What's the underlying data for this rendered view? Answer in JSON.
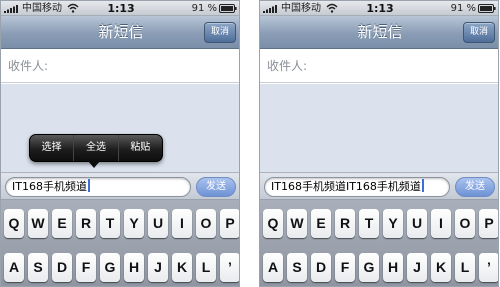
{
  "panels": [
    {
      "status": {
        "carrier": "中国移动",
        "time": "1:13",
        "battery_text": "91 %"
      },
      "nav": {
        "title": "新短信",
        "cancel_label": "取消"
      },
      "recipient": {
        "label": "收件人:"
      },
      "edit_menu": {
        "items": [
          "选择",
          "全选",
          "粘贴"
        ]
      },
      "compose": {
        "text": "IT168手机频道",
        "send_label": "发送"
      },
      "keyboard": {
        "row1": [
          "Q",
          "W",
          "E",
          "R",
          "T",
          "Y",
          "U",
          "I",
          "O",
          "P"
        ],
        "row2": [
          "A",
          "S",
          "D",
          "F",
          "G",
          "H",
          "J",
          "K",
          "L",
          "’"
        ]
      }
    },
    {
      "status": {
        "carrier": "中国移动",
        "time": "1:13",
        "battery_text": "91 %"
      },
      "nav": {
        "title": "新短信",
        "cancel_label": "取消"
      },
      "recipient": {
        "label": "收件人:"
      },
      "compose": {
        "text": "IT168手机频道IT168手机频道",
        "send_label": "发送"
      },
      "keyboard": {
        "row1": [
          "Q",
          "W",
          "E",
          "R",
          "T",
          "Y",
          "U",
          "I",
          "O",
          "P"
        ],
        "row2": [
          "A",
          "S",
          "D",
          "F",
          "G",
          "H",
          "J",
          "K",
          "L",
          "’"
        ]
      }
    }
  ]
}
